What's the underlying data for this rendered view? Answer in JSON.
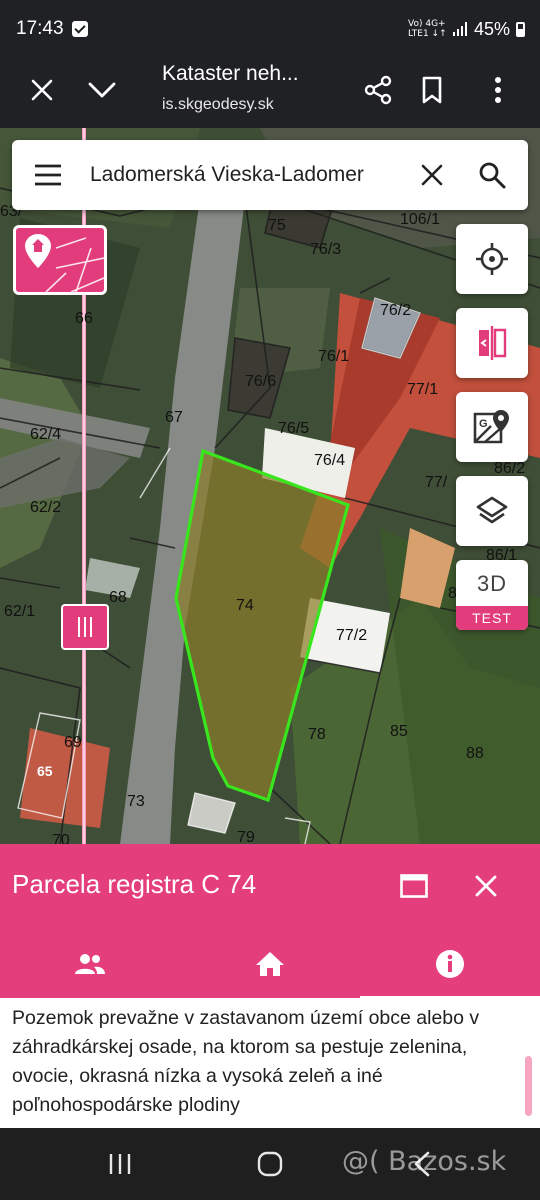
{
  "status_bar": {
    "time": "17:43",
    "network_line1": "Vo) 4G+",
    "network_line2": "LTE1 ↓↑",
    "battery": "45%"
  },
  "browser": {
    "title": "Kataster neh...",
    "url": "is.skgeodesy.sk",
    "icons": [
      "close-icon",
      "chevron-down-icon",
      "share-icon",
      "bookmark-icon",
      "more-vert-icon"
    ]
  },
  "search": {
    "query": "Ladomerská Vieska-Ladomer"
  },
  "map": {
    "parcel_labels": [
      "63/",
      "75",
      "76/3",
      "106/1",
      "66",
      "76/2",
      "76/1",
      "76/6",
      "77/1",
      "67",
      "62/4",
      "76/5",
      "76/4",
      "86/2",
      "77/",
      "62/2",
      "86/1",
      "68",
      "74",
      "62/1",
      "77/2",
      "8",
      "78",
      "85",
      "69",
      "65",
      "88",
      "73",
      "70",
      "79"
    ],
    "highlight_color": "#39e61e",
    "accent_color": "#e23c7c"
  },
  "fabs": {
    "three_d_label": "3D",
    "test_badge": "TEST"
  },
  "panel": {
    "title": "Parcela registra C 74",
    "description": "Pozemok prevažne v zastavanom území obce alebo v záhradkárskej osade, na ktorom sa pestuje zelenina, ovocie, okrasná nízka a vysoká zeleň a iné poľnohospodárske plodiny",
    "tabs": [
      "people-icon",
      "home-icon",
      "info-icon"
    ],
    "active_tab": "info-icon"
  },
  "navbar": {
    "watermark": "@( Bazos.sk"
  }
}
